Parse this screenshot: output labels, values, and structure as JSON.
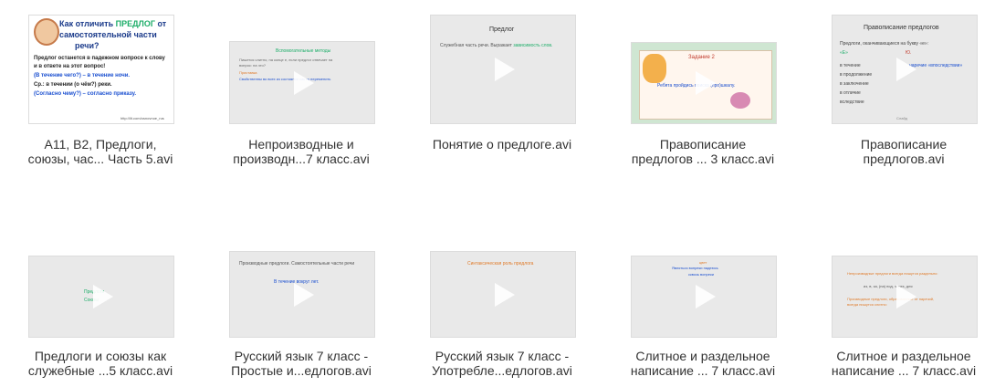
{
  "files": [
    {
      "caption_line1": "А11, В2, Предлоги,",
      "caption_line2": "союзы, час... Часть 5.avi",
      "thumb": {
        "title": "Как отличить ПРЕДЛОГ от самостоятельной части речи?",
        "title_part1": "Как отличить ",
        "title_highlight": "ПРЕДЛОГ",
        "title_part2": " от",
        "title_line2": "самостоятельной части",
        "title_line3": "речи?",
        "body1": "Предлог останется в падежном вопросе к слову",
        "body2": "и в ответе на этот вопрос!",
        "body3": "(В течение чего?) – в течение ночи.",
        "body4": "Ср.: в течении (о чём?) реки.",
        "body5": "(Согласно чему?) – согласно приказу.",
        "footer": "http://lit.com/osnovnoe_rus"
      }
    },
    {
      "caption_line1": "Непроизводные и",
      "caption_line2": "производн...7 класс.avi",
      "thumb": {
        "l1": "Вспомогательные методы",
        "l2": "Пишется слитно, на конце е, если предлог отвечает на",
        "l3": "вопрос: на что?",
        "l4": "Приставка",
        "l5": "Свойственны во всех из состоянии как то переменить"
      }
    },
    {
      "caption_line1": "Понятие о предлоге.avi",
      "caption_line2": "",
      "thumb": {
        "title": "Предлог",
        "text": "Служебная часть речи. Выражает ",
        "highlight": "зависимость слов."
      }
    },
    {
      "caption_line1": "Правописание",
      "caption_line2": "предлогов ... 3 класс.avi",
      "thumb": {
        "title": "Задание 2",
        "text": "Ребята пройдись поиска (про)шкалу."
      }
    },
    {
      "caption_line1": "Правописание",
      "caption_line2": "предлогов.avi",
      "thumb": {
        "title": "Правописание предлогов",
        "line1": "Предлоги, оканчивающиеся на букву «е»:",
        "left_head": "«Е»",
        "right_head": "Ю.",
        "item1": "в течение",
        "item2": "в продолжение",
        "item3": "в заключение",
        "item4": "в отличие",
        "item5": "вследствие",
        "right1": "наречие «впоследствии»",
        "footer": "Слайд"
      }
    },
    {
      "caption_line1": "Предлоги и союзы как",
      "caption_line2": "служебные ...5 класс.avi",
      "thumb": {
        "l1": "Предлоги",
        "l2": "Союзы"
      }
    },
    {
      "caption_line1": "Русский язык 7 класс -",
      "caption_line2": "Простые и...едлогов.avi",
      "thumb": {
        "title": "Производные предлоги.  Самостоятельные части речи",
        "text": "В течение вокруг лет."
      }
    },
    {
      "caption_line1": "Русский язык 7 класс -",
      "caption_line2": "Употребле...едлогов.avi",
      "thumb": {
        "title": "Синтаксическая роль предлога"
      }
    },
    {
      "caption_line1": "Слитное и раздельное",
      "caption_line2": "написание ... 7 класс.avi",
      "thumb": {
        "l1": "цвет",
        "l2": "Являться вопреки надеюсь",
        "l3": "сквозь вопреки"
      }
    },
    {
      "caption_line1": "Слитное и раздельное",
      "caption_line2": "написание ... 7 класс.avi",
      "thumb": {
        "l1": "Непроизводные предлоги всегда пишутся раздельно:",
        "l2": "из, в, за, (на) под, через, для",
        "l3": "Производные предлоги, образованные от наречий,",
        "l4": "всегда пишутся слитно:"
      }
    }
  ],
  "colors": {
    "thumb_bg": "#e9e9e9",
    "caption": "#333333",
    "accent_green": "#1fae6a",
    "accent_blue": "#1a4fd0",
    "accent_orange": "#e07b2a"
  }
}
